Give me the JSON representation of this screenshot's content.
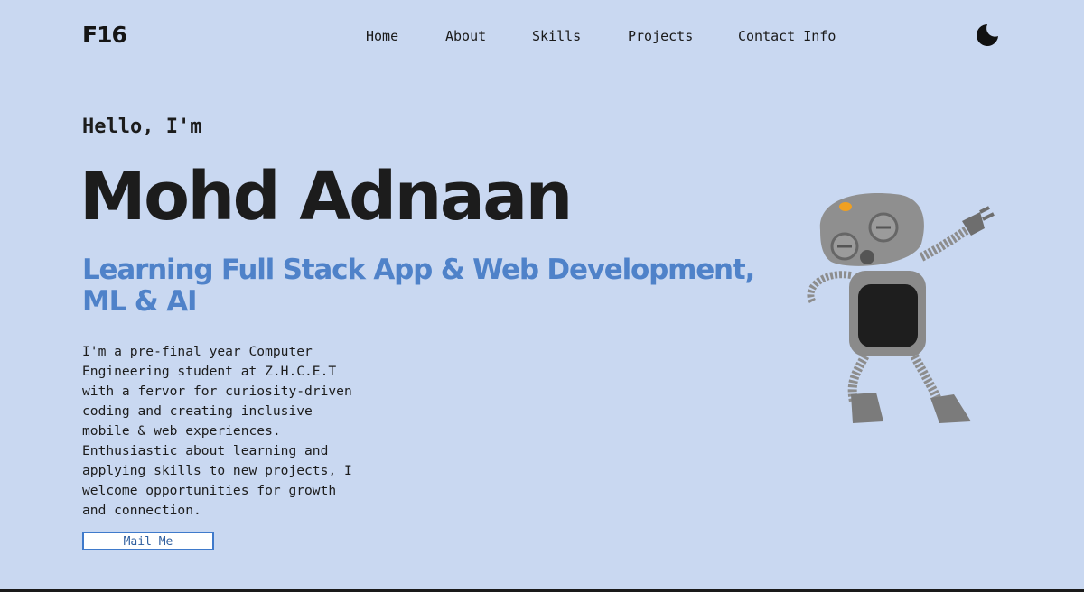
{
  "header": {
    "logo": "F16",
    "nav": [
      {
        "label": "Home"
      },
      {
        "label": "About"
      },
      {
        "label": "Skills"
      },
      {
        "label": "Projects"
      },
      {
        "label": "Contact Info"
      }
    ],
    "theme_toggle_icon": "moon-icon"
  },
  "hero": {
    "greeting": "Hello, I'm",
    "name": "Mohd Adnaan",
    "tagline": "Learning Full Stack App & Web Development, ML & AI",
    "bio_lines": [
      "I'm a pre-final year Computer",
      "Engineering student at Z.H.C.E.T",
      "with a fervor for curiosity-driven",
      "coding and creating inclusive",
      "mobile & web experiences.",
      "Enthusiastic about learning and",
      "applying skills to new projects, I",
      "welcome opportunities for growth",
      "and connection."
    ],
    "cta_label": "Mail Me",
    "illustration": "dabbing-robot-illustration"
  },
  "colors": {
    "background": "#c9d8f1",
    "accent": "#4f82c9",
    "text": "#1c1c1c"
  }
}
